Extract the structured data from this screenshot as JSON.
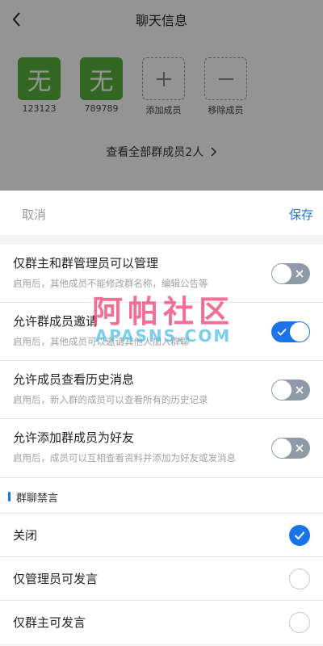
{
  "header": {
    "title": "聊天信息"
  },
  "members": [
    {
      "avatar_text": "无",
      "name": "123123"
    },
    {
      "avatar_text": "无",
      "name": "789789"
    }
  ],
  "member_actions": {
    "add_label": "添加成员",
    "remove_label": "移除成员"
  },
  "view_all_label": "查看全部群成员2人",
  "sheet": {
    "cancel_label": "取消",
    "save_label": "保存"
  },
  "settings": [
    {
      "title": "仅群主和群管理员可以管理",
      "desc": "启用后，其他成员不能修改群名称，编辑公告等",
      "enabled": false
    },
    {
      "title": "允许群成员邀请",
      "desc": "启用后，其他成员可以邀请其他人加入群聊",
      "enabled": true
    },
    {
      "title": "允许成员查看历史消息",
      "desc": "启用后，新入群的成员可以查看所有的历史记录",
      "enabled": false
    },
    {
      "title": "允许添加群成员为好友",
      "desc": "启用后，成员可以互相查看资料并添加为好友或发消息",
      "enabled": false
    }
  ],
  "mute_section": {
    "title": "群聊禁言",
    "options": [
      {
        "label": "关闭",
        "selected": true
      },
      {
        "label": "仅管理员可发言",
        "selected": false
      },
      {
        "label": "仅群主可发言",
        "selected": false
      }
    ]
  },
  "watermark": {
    "main": "阿帕社区",
    "sub": "APASNS.COM"
  },
  "colors": {
    "accent": "#1a73e8",
    "avatar_bg": "#55b23a",
    "toggle_off": "#8e9aa5"
  }
}
